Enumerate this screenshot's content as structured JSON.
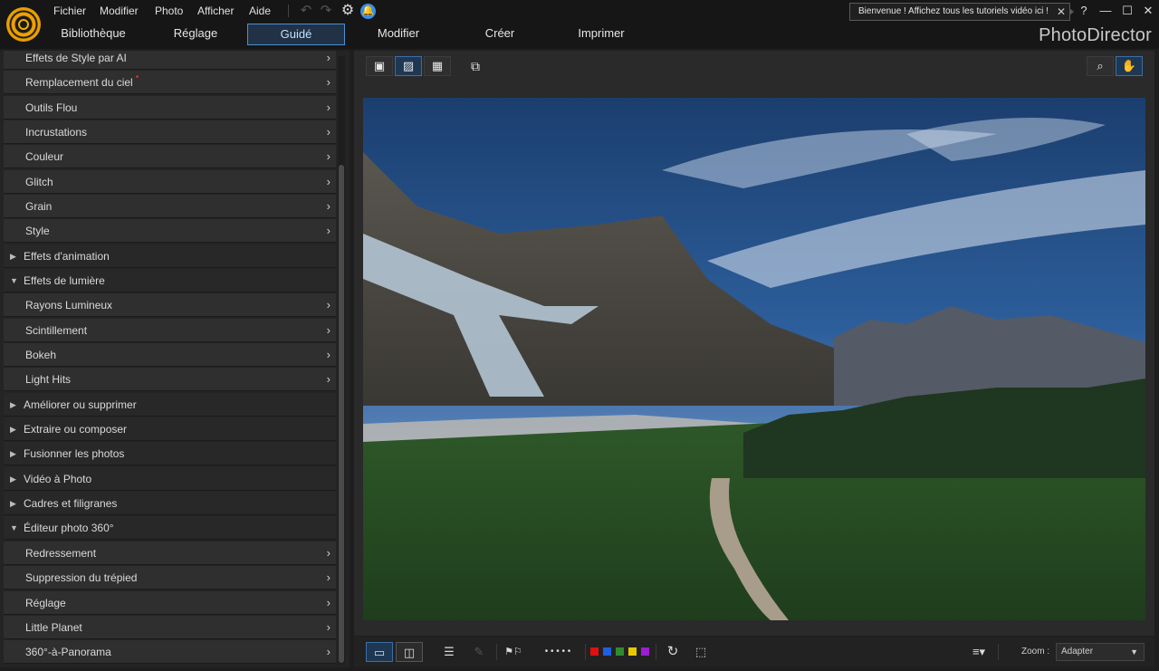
{
  "app": {
    "brand": "PhotoDirector",
    "menu": [
      "Fichier",
      "Modifier",
      "Photo",
      "Afficher",
      "Aide"
    ],
    "banner": "Bienvenue ! Affichez tous les tutoriels vidéo ici !",
    "help": "?"
  },
  "tabs": [
    "Bibliothèque",
    "Réglage",
    "Guidé",
    "Modifier",
    "Créer",
    "Imprimer"
  ],
  "active_tab": "Guidé",
  "sidebar": {
    "items": [
      {
        "label": "Effets de Style par AI",
        "kind": "sub"
      },
      {
        "label": "Remplacement du ciel",
        "kind": "sub",
        "new": "•"
      },
      {
        "label": "Outils Flou",
        "kind": "sub"
      },
      {
        "label": "Incrustations",
        "kind": "sub"
      },
      {
        "label": "Couleur",
        "kind": "sub"
      },
      {
        "label": "Glitch",
        "kind": "sub"
      },
      {
        "label": "Grain",
        "kind": "sub"
      },
      {
        "label": "Style",
        "kind": "sub"
      },
      {
        "label": "Effets d'animation",
        "kind": "cat",
        "expanded": false
      },
      {
        "label": "Effets de lumière",
        "kind": "cat",
        "expanded": true
      },
      {
        "label": "Rayons Lumineux",
        "kind": "sub"
      },
      {
        "label": "Scintillement",
        "kind": "sub"
      },
      {
        "label": "Bokeh",
        "kind": "sub"
      },
      {
        "label": "Light Hits",
        "kind": "sub"
      },
      {
        "label": "Améliorer ou supprimer",
        "kind": "cat",
        "expanded": false
      },
      {
        "label": "Extraire ou composer",
        "kind": "cat",
        "expanded": false
      },
      {
        "label": "Fusionner les photos",
        "kind": "cat",
        "expanded": false
      },
      {
        "label": "Vidéo à Photo",
        "kind": "cat",
        "expanded": false
      },
      {
        "label": "Cadres et filigranes",
        "kind": "cat",
        "expanded": false
      },
      {
        "label": "Éditeur photo 360°",
        "kind": "cat",
        "expanded": true
      },
      {
        "label": "Redressement",
        "kind": "sub"
      },
      {
        "label": "Suppression du trépied",
        "kind": "sub"
      },
      {
        "label": "Réglage",
        "kind": "sub"
      },
      {
        "label": "Little Planet",
        "kind": "sub"
      },
      {
        "label": "360°-à-Panorama",
        "kind": "sub"
      }
    ]
  },
  "bottom": {
    "zoom_label": "Zoom :",
    "zoom_value": "Adapter",
    "rating_dots": "• • • • •",
    "color_labels": [
      "#e01010",
      "#1f5fe0",
      "#2e8b2e",
      "#e8c800",
      "#9a1fd0"
    ]
  },
  "colors": {
    "accent": "#4a90d0",
    "logo": "#f0a000"
  }
}
